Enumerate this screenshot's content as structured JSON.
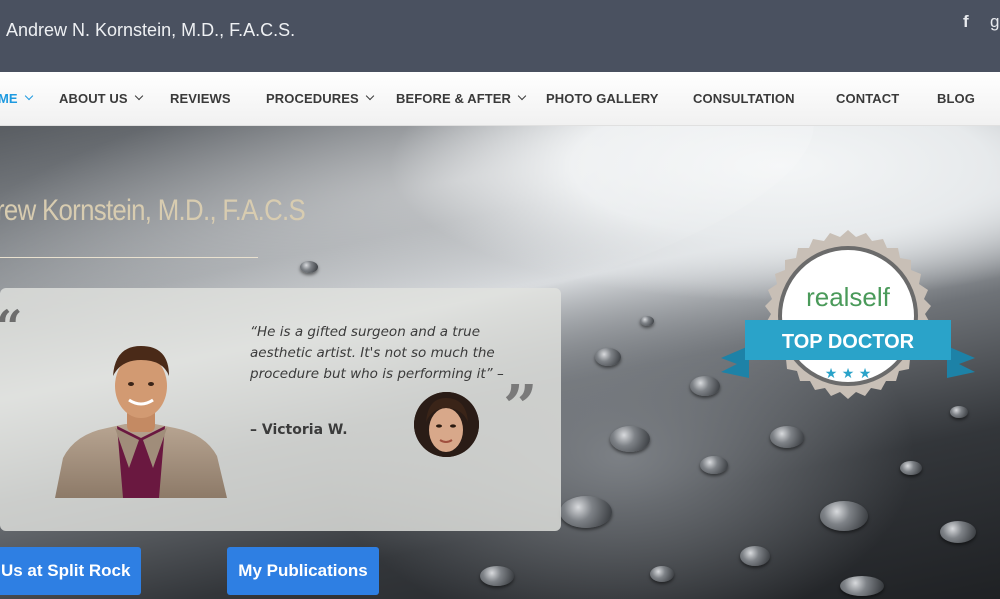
{
  "header": {
    "site_title": "Andrew N. Kornstein, M.D., F.A.C.S.",
    "social": {
      "facebook_glyph": "f",
      "google_glyph": "g"
    }
  },
  "nav": {
    "items": [
      {
        "label": "ME",
        "active": true,
        "has_dropdown": true
      },
      {
        "label": "ABOUT US",
        "has_dropdown": true
      },
      {
        "label": "REVIEWS",
        "has_dropdown": false
      },
      {
        "label": "PROCEDURES",
        "has_dropdown": true
      },
      {
        "label": "BEFORE & AFTER",
        "has_dropdown": true
      },
      {
        "label": "PHOTO GALLERY",
        "has_dropdown": false
      },
      {
        "label": "CONSULTATION",
        "has_dropdown": false
      },
      {
        "label": "CONTACT",
        "has_dropdown": false
      },
      {
        "label": "BLOG",
        "has_dropdown": false
      }
    ]
  },
  "hero": {
    "heading": "rew Kornstein, M.D., F.A.C.S",
    "testimonial": {
      "quote": "“He is a gifted surgeon and a true aesthetic artist. It's not so much the procedure but who is performing it” –",
      "author": "– Victoria W.",
      "open_quote_glyph": "“",
      "close_quote_glyph": "”"
    },
    "buttons": {
      "split_rock": "t Us at Split Rock",
      "publications": "My Publications"
    },
    "badge": {
      "brand": "realself",
      "ribbon": "TOP DOCTOR",
      "stars": "★ ★ ★"
    }
  },
  "colors": {
    "header_bg": "#4a5160",
    "nav_active": "#1e9ae0",
    "button_bg": "#2e7fe3",
    "badge_teal": "#2aa3c9",
    "heading_tan": "#d8ccb0"
  }
}
